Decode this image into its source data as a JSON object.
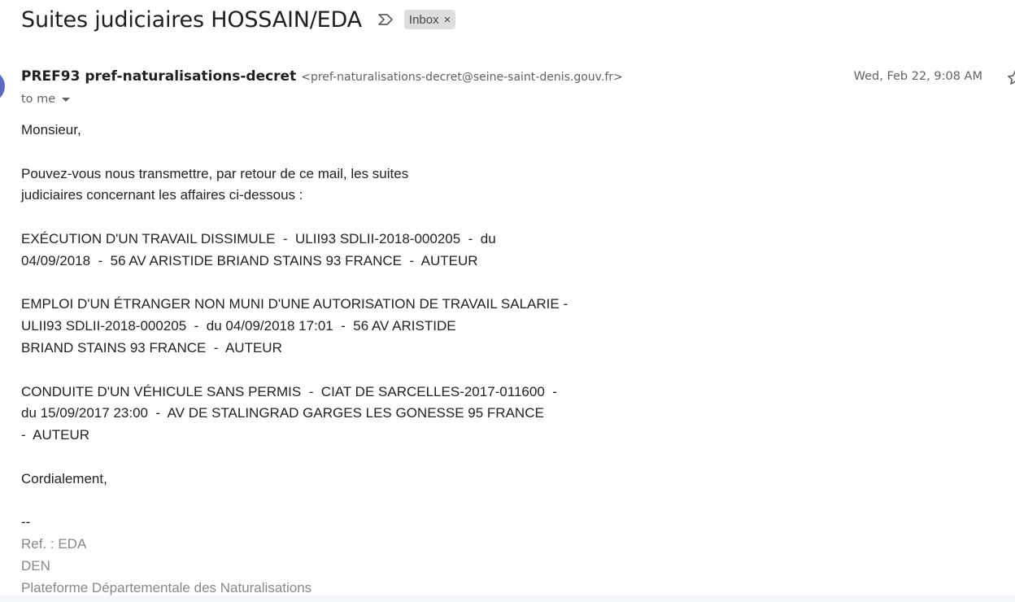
{
  "subject": "Suites judiciaires HOSSAIN/EDA",
  "label": {
    "name": "Inbox",
    "close": "×"
  },
  "sender": {
    "name": "PREF93 pref-naturalisations-decret",
    "email": "<pref-naturalisations-decret@seine-saint-denis.gouv.fr>"
  },
  "date": "Wed, Feb 22, 9:08 AM",
  "recipient": "to me",
  "body": {
    "line01": "Monsieur,",
    "line02": "",
    "line03": "Pouvez-vous nous transmettre, par retour de ce mail, les suites",
    "line04": "judiciaires concernant les affaires ci-dessous :",
    "line05": "",
    "line06": "EXÉCUTION D'UN TRAVAIL DISSIMULE  -  ULII93 SDLII-2018-000205  -  du",
    "line07": "04/09/2018  -  56 AV ARISTIDE BRIAND STAINS 93 FRANCE  -  AUTEUR",
    "line08": "",
    "line09": "EMPLOI D'UN ÉTRANGER NON MUNI D'UNE AUTORISATION DE TRAVAIL SALARIE -",
    "line10": "ULII93 SDLII-2018-000205  -  du 04/09/2018 17:01  -  56 AV ARISTIDE",
    "line11": "BRIAND STAINS 93 FRANCE  -  AUTEUR",
    "line12": "",
    "line13": "CONDUITE D'UN VÉHICULE SANS PERMIS  -  CIAT DE SARCELLES-2017-011600  -",
    "line14": "du 15/09/2017 23:00  -  AV DE STALINGRAD GARGES LES GONESSE 95 FRANCE",
    "line15": "-  AUTEUR",
    "line16": "",
    "line17": "Cordialement,",
    "line18": "",
    "line19": "--",
    "line20": "Ref. : EDA",
    "line21": "DEN",
    "line22": "Plateforme Départementale des Naturalisations"
  },
  "icons": {
    "important": "important-marker-icon",
    "star": "star-icon",
    "dropdown": "chevron-down-icon"
  },
  "colors": {
    "avatar": "#5c6bc0",
    "chip_bg": "#dddddd",
    "secondary_text": "#5f6368",
    "signature_text": "#888888"
  }
}
